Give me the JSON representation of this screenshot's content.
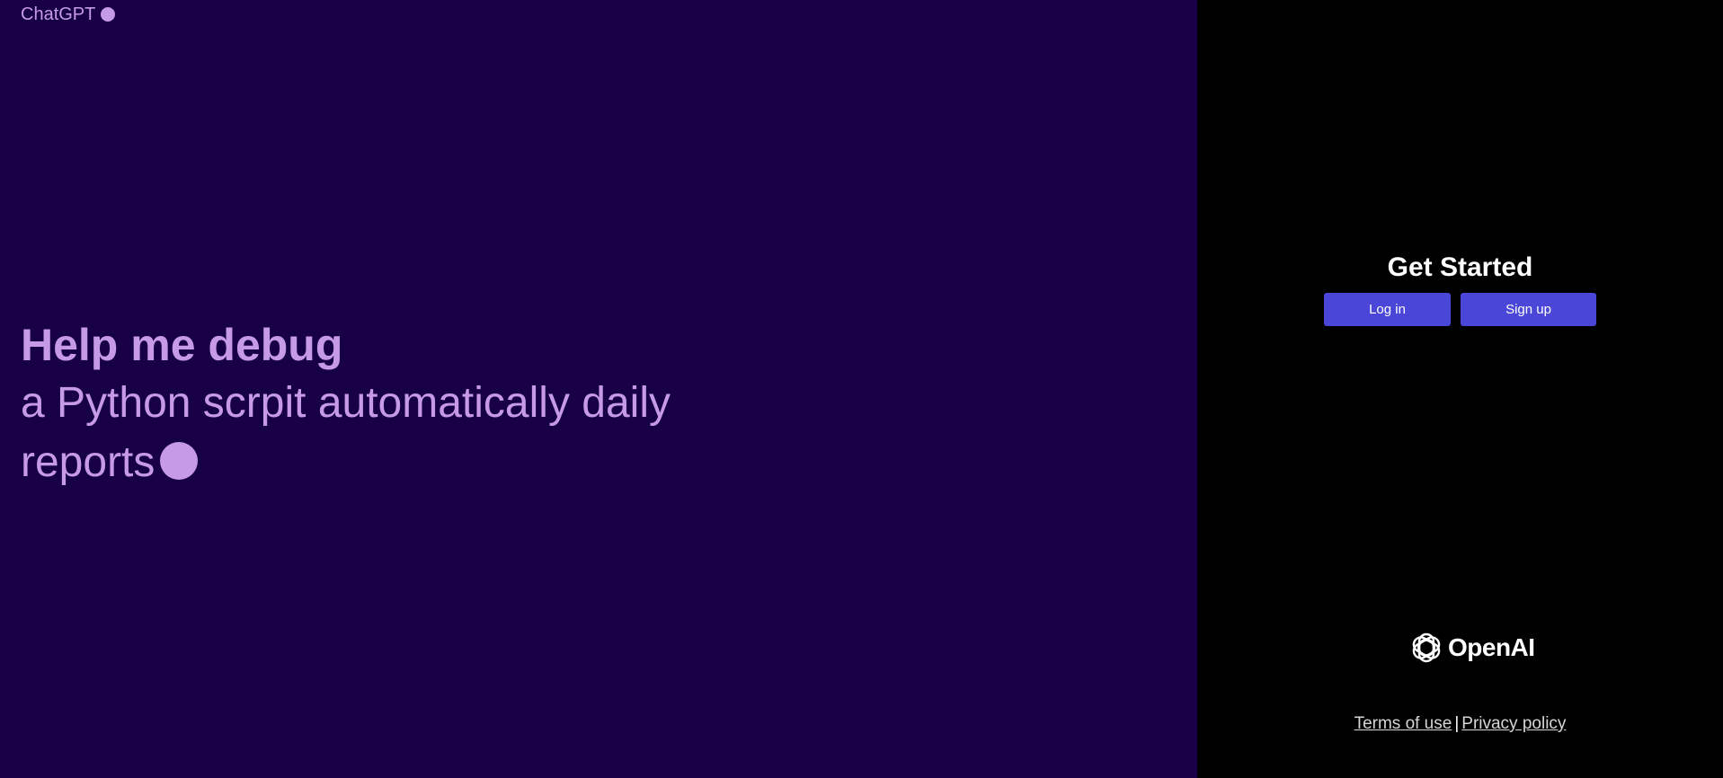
{
  "brand": {
    "name": "ChatGPT"
  },
  "hero": {
    "title": "Help me debug",
    "subtitle_line1": "a Python scrpit automatically daily",
    "subtitle_line2": "reports"
  },
  "auth": {
    "title": "Get Started",
    "login_label": "Log in",
    "signup_label": "Sign up"
  },
  "logo": {
    "icon": "openai-logo-icon",
    "text": "OpenAI"
  },
  "footer": {
    "terms_label": "Terms of use",
    "separator": "|",
    "privacy_label": "Privacy policy"
  },
  "colors": {
    "left_background": "#170045",
    "accent_text": "#c79ae8",
    "button": "#4a46d8",
    "right_background": "#000000"
  }
}
